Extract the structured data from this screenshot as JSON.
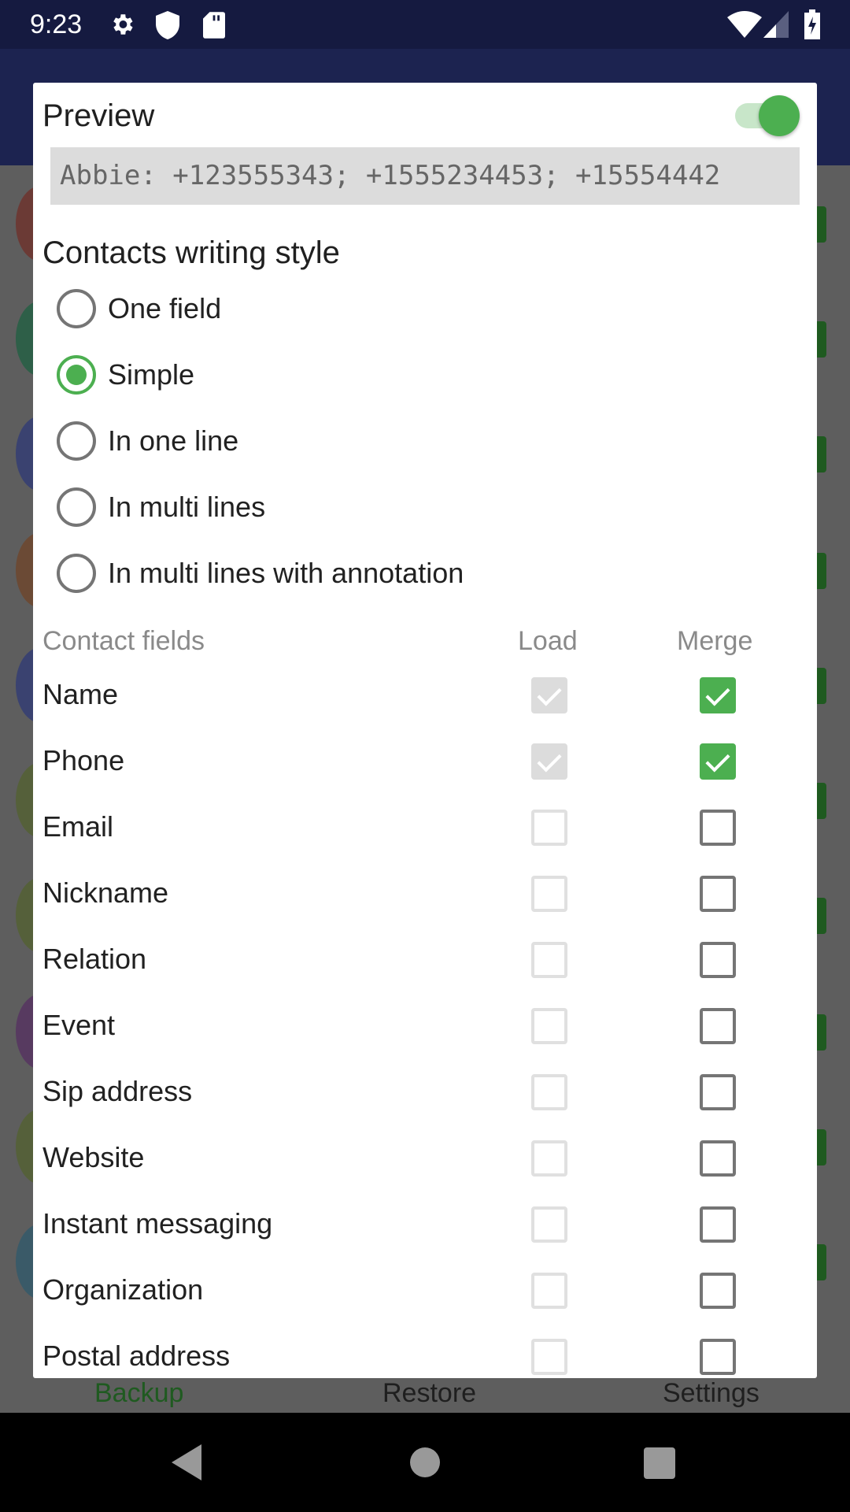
{
  "status_bar": {
    "time": "9:23",
    "icons": [
      "gear-icon",
      "shield-icon",
      "sd-card-icon",
      "wifi-icon",
      "signal-icon",
      "battery-charging-icon"
    ]
  },
  "background": {
    "bottom_tabs": [
      "Backup",
      "Restore",
      "Settings"
    ],
    "active_tab_color": "#1f5a20"
  },
  "dialog": {
    "preview_label": "Preview",
    "preview_enabled": true,
    "preview_text": "Abbie: +123555343; +1555234453; +15554442",
    "style_title": "Contacts writing style",
    "styles": [
      {
        "label": "One field",
        "selected": false
      },
      {
        "label": "Simple",
        "selected": true
      },
      {
        "label": "In one line",
        "selected": false
      },
      {
        "label": "In multi lines",
        "selected": false
      },
      {
        "label": "In multi lines with annotation",
        "selected": false
      }
    ],
    "fields_header": {
      "name": "Contact fields",
      "load": "Load",
      "merge": "Merge"
    },
    "fields": [
      {
        "label": "Name",
        "load": true,
        "load_disabled": true,
        "merge": true
      },
      {
        "label": "Phone",
        "load": true,
        "load_disabled": true,
        "merge": true
      },
      {
        "label": "Email",
        "load": false,
        "load_disabled": true,
        "merge": false
      },
      {
        "label": "Nickname",
        "load": false,
        "load_disabled": true,
        "merge": false
      },
      {
        "label": "Relation",
        "load": false,
        "load_disabled": true,
        "merge": false
      },
      {
        "label": "Event",
        "load": false,
        "load_disabled": true,
        "merge": false
      },
      {
        "label": "Sip address",
        "load": false,
        "load_disabled": true,
        "merge": false
      },
      {
        "label": "Website",
        "load": false,
        "load_disabled": true,
        "merge": false
      },
      {
        "label": "Instant messaging",
        "load": false,
        "load_disabled": true,
        "merge": false
      },
      {
        "label": "Organization",
        "load": false,
        "load_disabled": true,
        "merge": false
      },
      {
        "label": "Postal address",
        "load": false,
        "load_disabled": true,
        "merge": false
      }
    ],
    "accent_color": "#4caf50"
  }
}
